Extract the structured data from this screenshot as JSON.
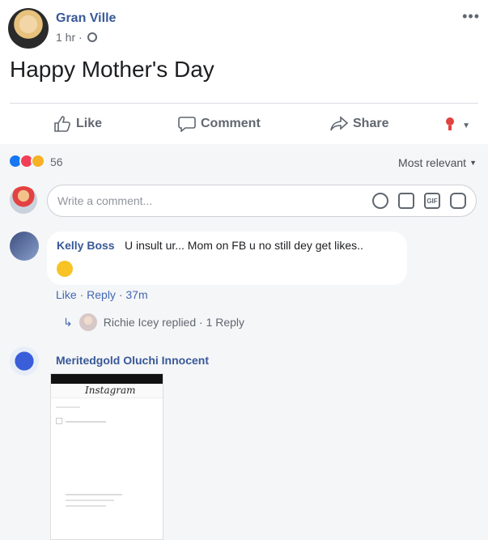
{
  "post": {
    "author": "Gran Ville",
    "time": "1 hr ·",
    "text": "Happy Mother's Day",
    "more_label": "•••"
  },
  "actions": {
    "like": "Like",
    "comment": "Comment",
    "share": "Share"
  },
  "reactions": {
    "count": "56",
    "sort_label": "Most relevant"
  },
  "compose": {
    "placeholder": "Write a comment...",
    "gif_label": "GIF"
  },
  "comments": [
    {
      "author": "Kelly Boss",
      "text": "U insult ur... Mom on FB u no still dey get likes..",
      "like": "Like",
      "reply": "Reply",
      "time": "37m",
      "reply_summary": {
        "who": "Richie Icey replied",
        "count": "1 Reply"
      }
    },
    {
      "author": "Meritedgold Oluchi Innocent",
      "image_app_title": "Instagram"
    }
  ]
}
